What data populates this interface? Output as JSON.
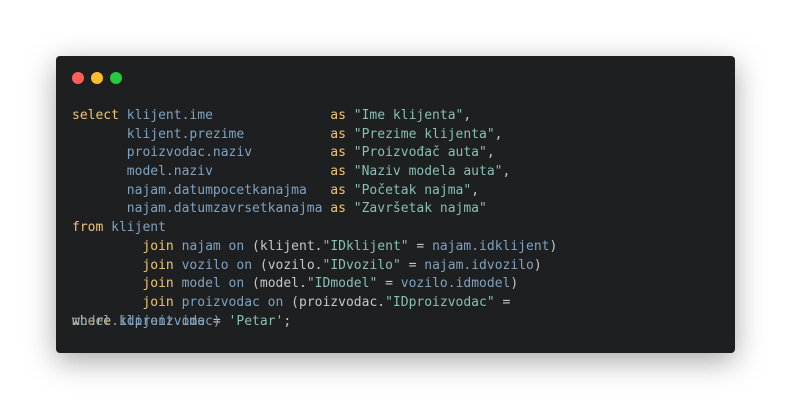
{
  "window": {
    "controls": [
      "close",
      "minimize",
      "zoom"
    ],
    "colors": {
      "background": "#1d1f21",
      "keyword": "#f0c674",
      "identifier": "#81a2be",
      "string": "#8abeb7"
    }
  },
  "code": {
    "lines": [
      [
        {
          "t": "select ",
          "c": "kw"
        },
        {
          "t": "klijent.ime               ",
          "c": "id"
        },
        {
          "t": "as ",
          "c": "kw"
        },
        {
          "t": "\"Ime klijenta\"",
          "c": "str2"
        },
        {
          "t": ",",
          "c": "op"
        }
      ],
      [
        {
          "t": "       ",
          "c": "op"
        },
        {
          "t": "klijent.prezime           ",
          "c": "id"
        },
        {
          "t": "as ",
          "c": "kw"
        },
        {
          "t": "\"Prezime klijenta\"",
          "c": "str2"
        },
        {
          "t": ",",
          "c": "op"
        }
      ],
      [
        {
          "t": "       ",
          "c": "op"
        },
        {
          "t": "proizvodac.naziv          ",
          "c": "id"
        },
        {
          "t": "as ",
          "c": "kw"
        },
        {
          "t": "\"Proizvođač auta\"",
          "c": "str2"
        },
        {
          "t": ",",
          "c": "op"
        }
      ],
      [
        {
          "t": "       ",
          "c": "op"
        },
        {
          "t": "model.naziv               ",
          "c": "id"
        },
        {
          "t": "as ",
          "c": "kw"
        },
        {
          "t": "\"Naziv modela auta\"",
          "c": "str2"
        },
        {
          "t": ",",
          "c": "op"
        }
      ],
      [
        {
          "t": "       ",
          "c": "op"
        },
        {
          "t": "najam.datumpocetkanajma   ",
          "c": "id"
        },
        {
          "t": "as ",
          "c": "kw"
        },
        {
          "t": "\"Početak najma\"",
          "c": "str2"
        },
        {
          "t": ",",
          "c": "op"
        }
      ],
      [
        {
          "t": "       ",
          "c": "op"
        },
        {
          "t": "najam.datumzavrsetkanajma ",
          "c": "id"
        },
        {
          "t": "as ",
          "c": "kw"
        },
        {
          "t": "\"Završetak najma\"",
          "c": "str2"
        }
      ],
      [
        {
          "t": "from ",
          "c": "kw"
        },
        {
          "t": "klijent",
          "c": "id"
        }
      ],
      [
        {
          "t": "         ",
          "c": "op"
        },
        {
          "t": "join ",
          "c": "kw"
        },
        {
          "t": "najam on ",
          "c": "id"
        },
        {
          "t": "(klijent.",
          "c": "op"
        },
        {
          "t": "\"IDklijent\"",
          "c": "str2"
        },
        {
          "t": " = ",
          "c": "op"
        },
        {
          "t": "najam.idklijent",
          "c": "id"
        },
        {
          "t": ")",
          "c": "op"
        }
      ],
      [
        {
          "t": "         ",
          "c": "op"
        },
        {
          "t": "join ",
          "c": "kw"
        },
        {
          "t": "vozilo on ",
          "c": "id"
        },
        {
          "t": "(vozilo.",
          "c": "op"
        },
        {
          "t": "\"IDvozilo\"",
          "c": "str2"
        },
        {
          "t": " = ",
          "c": "op"
        },
        {
          "t": "najam.idvozilo",
          "c": "id"
        },
        {
          "t": ")",
          "c": "op"
        }
      ],
      [
        {
          "t": "         ",
          "c": "op"
        },
        {
          "t": "join ",
          "c": "kw"
        },
        {
          "t": "model on ",
          "c": "id"
        },
        {
          "t": "(model.",
          "c": "op"
        },
        {
          "t": "\"IDmodel\"",
          "c": "str2"
        },
        {
          "t": " = ",
          "c": "op"
        },
        {
          "t": "vozilo.idmodel",
          "c": "id"
        },
        {
          "t": ")",
          "c": "op"
        }
      ],
      [
        {
          "t": "         ",
          "c": "op"
        },
        {
          "t": "join ",
          "c": "kw"
        },
        {
          "t": "proizvodac on ",
          "c": "id"
        },
        {
          "t": "(proizvodac.",
          "c": "op"
        },
        {
          "t": "\"IDproizvodac\"",
          "c": "str2"
        },
        {
          "t": " =",
          "c": "op"
        }
      ]
    ],
    "overlap_line_a": [
      {
        "t": "where ",
        "c": "kw"
      },
      {
        "t": "klijent.ime ",
        "c": "id"
      },
      {
        "t": "= ",
        "c": "op"
      },
      {
        "t": "'Petar'",
        "c": "str2"
      },
      {
        "t": ";",
        "c": "op"
      }
    ],
    "overlap_line_b": [
      {
        "t": "model.idproizvodac)",
        "c": "id"
      }
    ]
  }
}
